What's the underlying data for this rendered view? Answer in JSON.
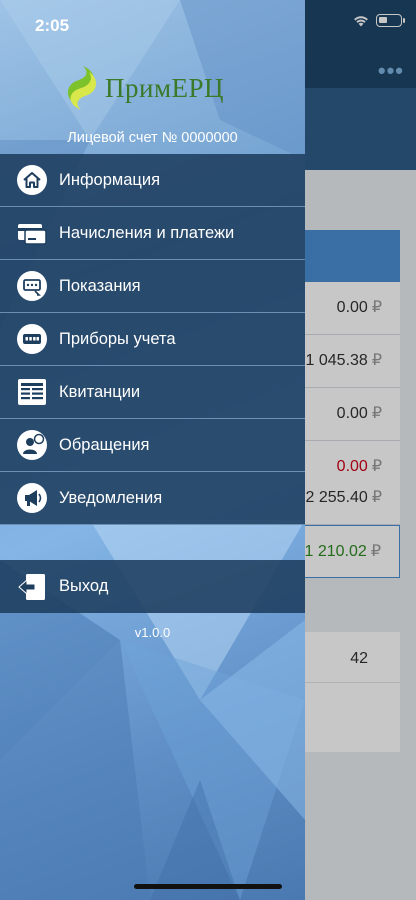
{
  "status_bar": {
    "time": "2:05"
  },
  "app": {
    "logo_text": "ПримЕРЦ",
    "account_label": "Лицевой счет № 0000000",
    "version": "v1.0.0"
  },
  "menu": {
    "items": [
      {
        "label": "Информация",
        "icon": "home-icon"
      },
      {
        "label": "Начисления и платежи",
        "icon": "credit-card-icon"
      },
      {
        "label": "Показания",
        "icon": "meter-readings-icon"
      },
      {
        "label": "Приборы учета",
        "icon": "meter-device-icon"
      },
      {
        "label": "Квитанции",
        "icon": "receipt-icon"
      },
      {
        "label": "Обращения",
        "icon": "user-message-icon"
      },
      {
        "label": "Уведомления",
        "icon": "megaphone-icon"
      }
    ],
    "logout_label": "Выход",
    "logout_icon": "exit-icon"
  },
  "background_screen": {
    "rows": [
      {
        "value": "0.00",
        "currency": "₽"
      },
      {
        "value": "1 045.38",
        "currency": "₽"
      },
      {
        "value": "0.00",
        "currency": "₽"
      },
      {
        "value": "0.00",
        "currency": "₽"
      },
      {
        "value": "2 255.40",
        "currency": "₽"
      },
      {
        "value": "1 210.02",
        "currency": "₽"
      }
    ],
    "second_card_value": "42"
  },
  "colors": {
    "menu_bg": "#1e3e5e",
    "header_bg": "#1e4668",
    "accent_blue": "#4a8fd4",
    "negative": "#d0021b",
    "positive": "#2e8b22",
    "logo_green": "#3a7a2a"
  }
}
